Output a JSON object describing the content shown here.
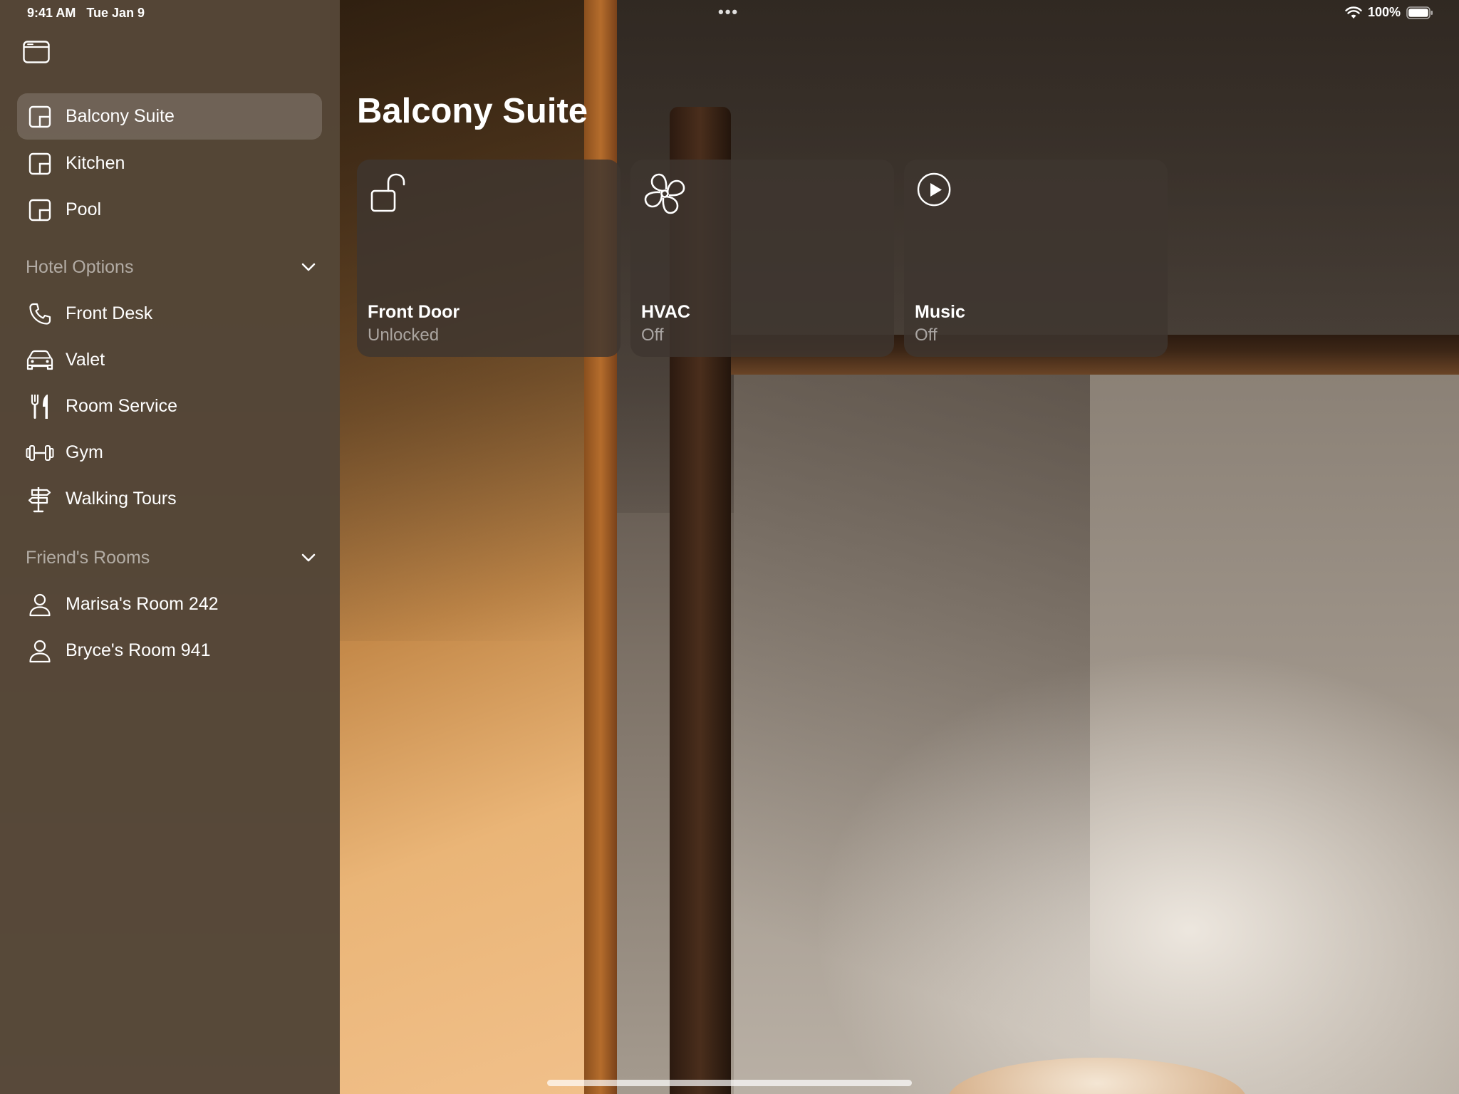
{
  "status_bar": {
    "time": "9:41 AM",
    "date": "Tue Jan 9",
    "battery": "100%",
    "icons": [
      "wifi-icon",
      "battery-icon",
      "more-dots-icon"
    ]
  },
  "sidebar": {
    "toggle_icon": "sidebar-toggle-icon",
    "rooms": [
      {
        "label": "Balcony Suite",
        "icon": "room-icon",
        "selected": true
      },
      {
        "label": "Kitchen",
        "icon": "room-icon",
        "selected": false
      },
      {
        "label": "Pool",
        "icon": "room-icon",
        "selected": false
      }
    ],
    "hotel_options": {
      "title": "Hotel Options",
      "items": [
        {
          "label": "Front Desk",
          "icon": "phone-icon"
        },
        {
          "label": "Valet",
          "icon": "car-icon"
        },
        {
          "label": "Room Service",
          "icon": "fork-knife-icon"
        },
        {
          "label": "Gym",
          "icon": "dumbbell-icon"
        },
        {
          "label": "Walking Tours",
          "icon": "signpost-icon"
        }
      ]
    },
    "friends_rooms": {
      "title": "Friend's Rooms",
      "items": [
        {
          "label": "Marisa's Room 242",
          "icon": "person-icon"
        },
        {
          "label": "Bryce's Room 941",
          "icon": "person-icon"
        }
      ]
    }
  },
  "main": {
    "title": "Balcony Suite",
    "tiles": [
      {
        "name": "Front Door",
        "state": "Unlocked",
        "icon": "unlocked-lock-icon"
      },
      {
        "name": "HVAC",
        "state": "Off",
        "icon": "fan-icon"
      },
      {
        "name": "Music",
        "state": "Off",
        "icon": "play-circle-icon"
      }
    ]
  },
  "colors": {
    "sidebar_bg": "#544636",
    "tile_bg": "#3e3630",
    "text_primary": "#ffffff",
    "text_secondary": "#a8a29a"
  }
}
